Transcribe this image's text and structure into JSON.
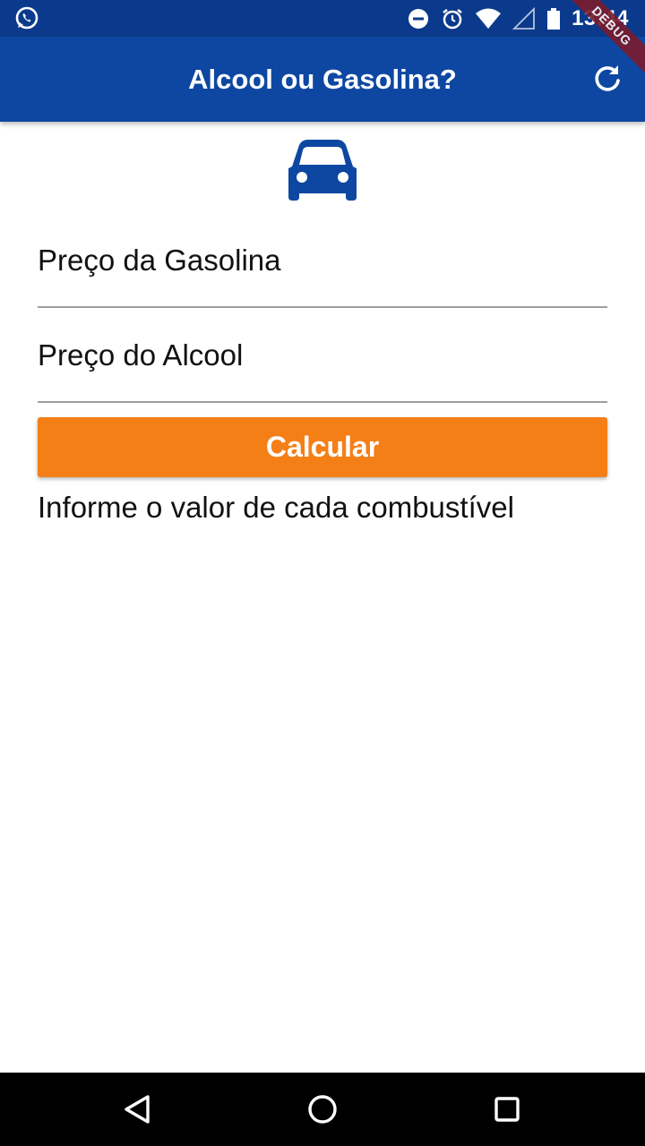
{
  "status_bar": {
    "time": "13:44",
    "icons": [
      "whatsapp-icon",
      "do-not-disturb-icon",
      "alarm-icon",
      "wifi-icon",
      "signal-icon",
      "battery-icon"
    ]
  },
  "debug_banner": "DEBUG",
  "app_bar": {
    "title": "Alcool ou Gasolina?",
    "action_icon": "refresh-icon",
    "color": "#0d47a1"
  },
  "form": {
    "header_icon": "car-icon",
    "gasolina": {
      "placeholder": "Preço da Gasolina",
      "value": ""
    },
    "alcool": {
      "placeholder": "Preço do Alcool",
      "value": ""
    },
    "calculate_label": "Calcular",
    "button_color": "#f57f17",
    "result_text": "Informe o valor de cada combustível"
  },
  "nav_bar": {
    "icons": [
      "back-icon",
      "home-icon",
      "recents-icon"
    ]
  }
}
